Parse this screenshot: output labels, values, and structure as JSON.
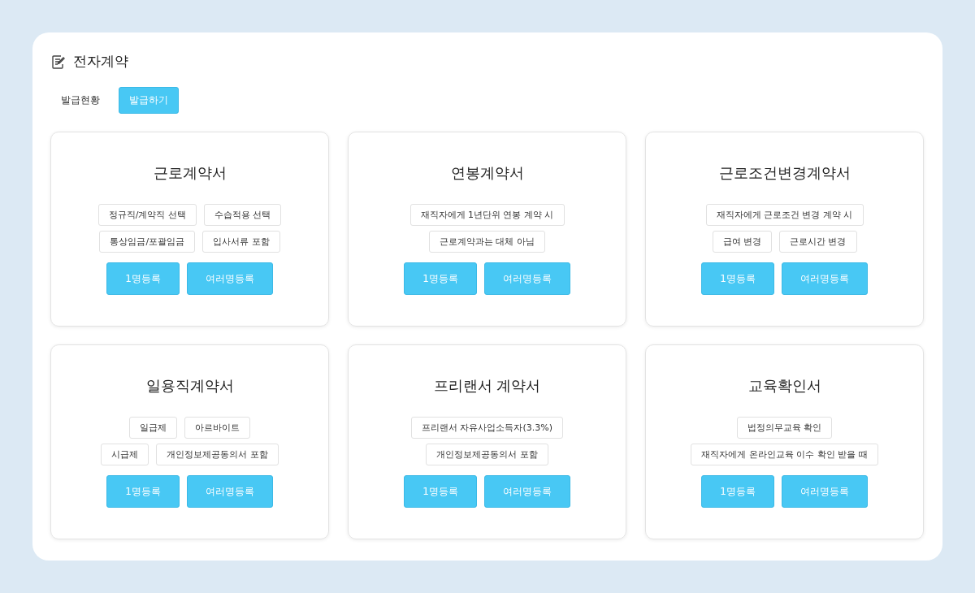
{
  "header": {
    "title": "전자계약"
  },
  "tabs": [
    {
      "label": "발급현황",
      "selected": false
    },
    {
      "label": "발급하기",
      "selected": true
    }
  ],
  "cards": [
    {
      "title": "근로계약서",
      "tag_rows": [
        [
          "정규직/계약직 선택",
          "수습적용 선택"
        ],
        [
          "통상임금/포괄임금",
          "입사서류 포함"
        ]
      ],
      "buttons": [
        "1명등록",
        "여러명등록"
      ]
    },
    {
      "title": "연봉계약서",
      "tag_rows": [
        [
          "재직자에게 1년단위 연봉 계약 시"
        ],
        [
          "근로계약과는 대체 아님"
        ]
      ],
      "buttons": [
        "1명등록",
        "여러명등록"
      ]
    },
    {
      "title": "근로조건변경계약서",
      "tag_rows": [
        [
          "재직자에게 근로조건 변경 계약 시"
        ],
        [
          "급여 변경",
          "근로시간 변경"
        ]
      ],
      "buttons": [
        "1명등록",
        "여러명등록"
      ]
    },
    {
      "title": "일용직계약서",
      "tag_rows": [
        [
          "일급제",
          "아르바이트"
        ],
        [
          "시급제",
          "개인정보제공동의서 포함"
        ]
      ],
      "buttons": [
        "1명등록",
        "여러명등록"
      ]
    },
    {
      "title": "프리랜서 계약서",
      "tag_rows": [
        [
          "프리랜서 자유사업소득자(3.3%)"
        ],
        [
          "개인정보제공동의서 포함"
        ]
      ],
      "buttons": [
        "1명등록",
        "여러명등록"
      ]
    },
    {
      "title": "교육확인서",
      "tag_rows": [
        [
          "법정의무교육 확인"
        ],
        [
          "재직자에게 온라인교육 이수 확인 받을 때"
        ]
      ],
      "buttons": [
        "1명등록",
        "여러명등록"
      ]
    }
  ]
}
